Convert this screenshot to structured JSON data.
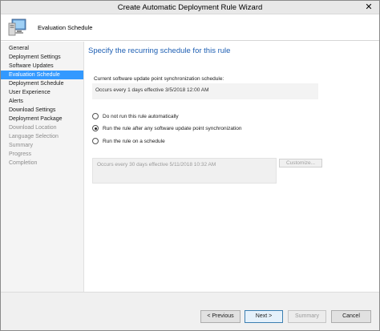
{
  "window": {
    "title": "Create Automatic Deployment Rule Wizard",
    "close_glyph": "✕"
  },
  "header": {
    "page_name": "Evaluation Schedule"
  },
  "nav": {
    "items": [
      {
        "label": "General",
        "state": "normal"
      },
      {
        "label": "Deployment Settings",
        "state": "normal"
      },
      {
        "label": "Software Updates",
        "state": "normal"
      },
      {
        "label": "Evaluation Schedule",
        "state": "active"
      },
      {
        "label": "Deployment Schedule",
        "state": "normal"
      },
      {
        "label": "User Experience",
        "state": "normal"
      },
      {
        "label": "Alerts",
        "state": "normal"
      },
      {
        "label": "Download Settings",
        "state": "normal"
      },
      {
        "label": "Deployment Package",
        "state": "normal"
      },
      {
        "label": "Download Location",
        "state": "disabled"
      },
      {
        "label": "Language Selection",
        "state": "disabled"
      },
      {
        "label": "Summary",
        "state": "disabled"
      },
      {
        "label": "Progress",
        "state": "disabled"
      },
      {
        "label": "Completion",
        "state": "disabled"
      }
    ]
  },
  "content": {
    "heading": "Specify the recurring schedule for this rule",
    "sync_schedule_label": "Current software update point synchronization schedule:",
    "sync_schedule_value": "Occurs every 1 days effective 3/5/2018 12:00 AM",
    "options": [
      {
        "label": "Do not run this rule automatically",
        "checked": false
      },
      {
        "label": "Run the rule after any software update point synchronization",
        "checked": true
      },
      {
        "label": "Run the rule on a schedule",
        "checked": false
      }
    ],
    "schedule_value": "Occurs every 30 days effective 5/11/2018 10:32 AM",
    "customize_label": "Customize..."
  },
  "footer": {
    "previous_label": "< Previous",
    "next_label": "Next >",
    "summary_label": "Summary",
    "cancel_label": "Cancel"
  },
  "colors": {
    "heading": "#1e5fb3",
    "nav_active_bg": "#3399ff",
    "nav_disabled_text": "#8c8c8c"
  },
  "icons": {
    "wizard": "computer-monitor-icon",
    "close": "close-icon"
  }
}
